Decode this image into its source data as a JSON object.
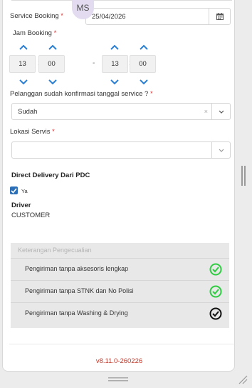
{
  "user": {
    "initials": "MS"
  },
  "service_booking": {
    "label": "Service Booking",
    "required_mark": "*",
    "date": "25/04/2026",
    "calendar_icon": "calendar-icon"
  },
  "jam_booking": {
    "label": "Jam Booking",
    "required_mark": "*",
    "start": {
      "hour": "13",
      "minute": "00"
    },
    "end": {
      "hour": "13",
      "minute": "00"
    },
    "separator": "-",
    "colon": ":"
  },
  "konfirmasi": {
    "label": "Pelanggan sudah konfirmasi tanggal service ?",
    "required_mark": "*",
    "value": "Sudah",
    "clear": "×"
  },
  "lokasi": {
    "label": "Lokasi Servis",
    "required_mark": "*",
    "value": ""
  },
  "direct_delivery": {
    "label": "Direct Delivery Dari PDC",
    "checkbox_label": "Ya",
    "checked": true
  },
  "driver": {
    "label": "Driver",
    "value": "CUSTOMER"
  },
  "exceptions": {
    "header": "Keterangan Pengecualian",
    "items": [
      {
        "text": "Pengiriman tanpa aksesoris lengkap",
        "icon": "check-circle-green-icon",
        "color": "#2ecc40"
      },
      {
        "text": "Pengiriman tanpa STNK dan No Polisi",
        "icon": "check-circle-green-icon",
        "color": "#2ecc40"
      },
      {
        "text": "Pengiriman tanpa Washing & Drying",
        "icon": "check-circle-black-icon",
        "color": "#111111"
      }
    ]
  },
  "version": "v8.11.0-260226",
  "colors": {
    "accent_blue": "#2a7fd4",
    "version_red": "#c0392b",
    "required_red": "#dd3333"
  }
}
